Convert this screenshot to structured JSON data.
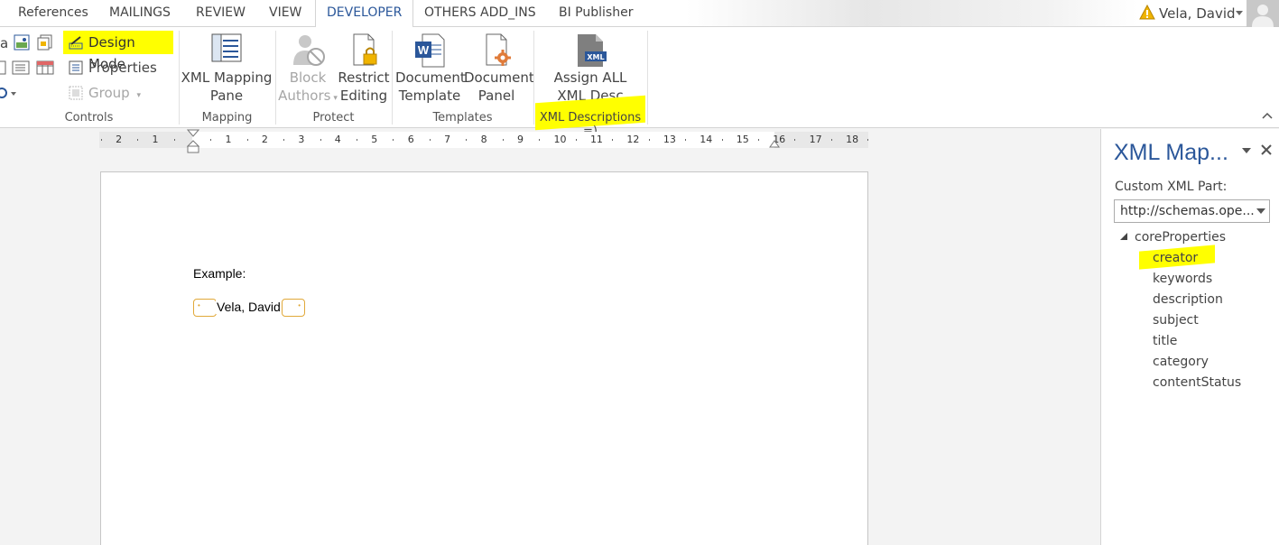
{
  "tabs": [
    {
      "label": "References"
    },
    {
      "label": "MAILINGS"
    },
    {
      "label": "REVIEW"
    },
    {
      "label": "VIEW"
    },
    {
      "label": "DEVELOPER"
    },
    {
      "label": "OTHERS ADD_INS"
    },
    {
      "label": "BI Publisher"
    }
  ],
  "account": {
    "user": "Vela, David"
  },
  "ribbon": {
    "controls": {
      "design_mode": "Design Mode",
      "properties": "Properties",
      "group": "Group",
      "partial_label": "a",
      "group_label": "Controls"
    },
    "mapping": {
      "button": "XML Mapping",
      "button2": "Pane",
      "group_label": "Mapping"
    },
    "protect": {
      "block_l1": "Block",
      "block_l2": "Authors",
      "restrict_l1": "Restrict",
      "restrict_l2": "Editing",
      "group_label": "Protect"
    },
    "templates": {
      "doc_template_l1": "Document",
      "doc_template_l2": "Template",
      "doc_panel_l1": "Document",
      "doc_panel_l2": "Panel",
      "group_label": "Templates"
    },
    "xml_desc": {
      "button_l1": "Assign ALL",
      "button_l2": "XML Desc",
      "group_label": "XML Descriptions =)",
      "icon_badge": "XML"
    }
  },
  "ruler": {
    "left_ticks": [
      "2",
      "1"
    ],
    "right_ticks": [
      "1",
      "2",
      "3",
      "4",
      "5",
      "6",
      "7",
      "8",
      "9",
      "10",
      "11",
      "12",
      "13",
      "14",
      "15",
      "16",
      "17",
      "18"
    ]
  },
  "document": {
    "example_label": "Example:",
    "content_control_value": "Vela, David"
  },
  "xml_pane": {
    "title": "XML Map...",
    "custom_part_label": "Custom XML Part:",
    "custom_part_value": "http://schemas.ope...",
    "root": "coreProperties",
    "children": [
      "creator",
      "keywords",
      "description",
      "subject",
      "title",
      "category",
      "contentStatus"
    ]
  },
  "colors": {
    "accent": "#2b579a",
    "highlight": "#ffff00",
    "cc_border": "#e1a93a"
  }
}
